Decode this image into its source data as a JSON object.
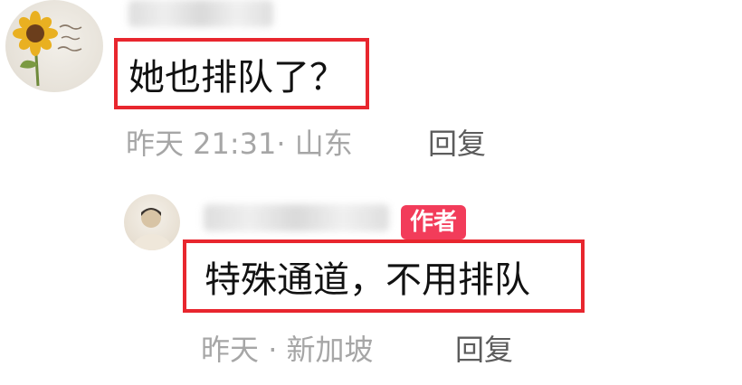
{
  "comments": [
    {
      "text": "她也排队了？",
      "time": "昨天 21:31",
      "location": "山东",
      "reply_label": "回复"
    }
  ],
  "replies": [
    {
      "author_badge": "作者",
      "text": "特殊通道，不用排队",
      "time": "昨天",
      "location": "新加坡",
      "reply_label": "回复"
    }
  ]
}
